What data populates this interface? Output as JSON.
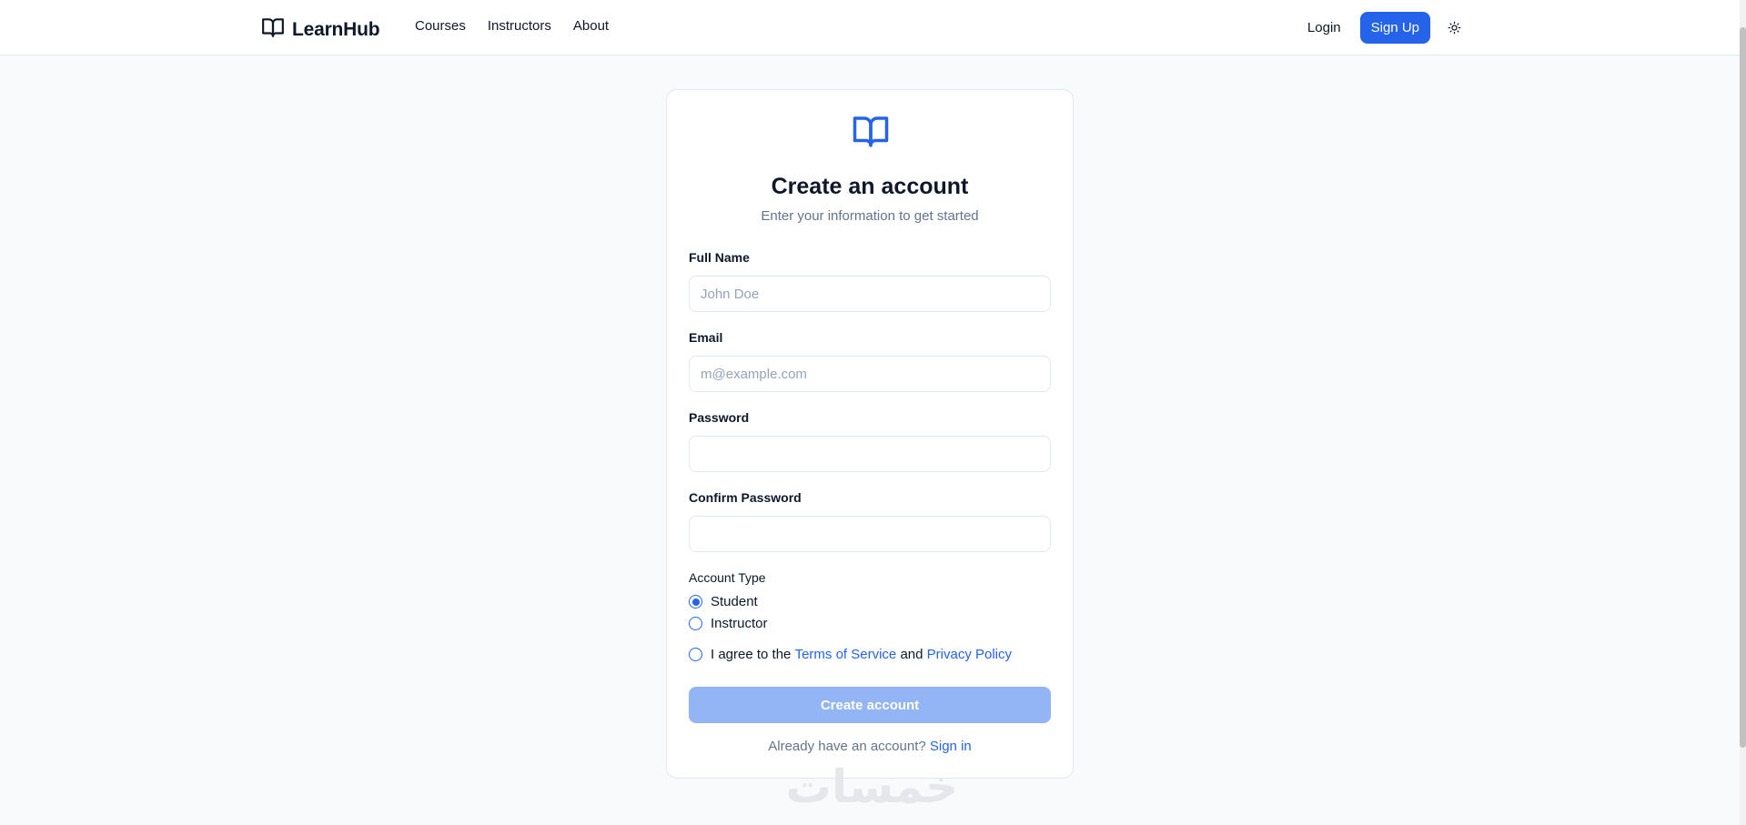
{
  "nav": {
    "brand": "LearnHub",
    "links": [
      "Courses",
      "Instructors",
      "About"
    ],
    "login": "Login",
    "signup": "Sign Up"
  },
  "card": {
    "title": "Create an account",
    "subtitle": "Enter your information to get started",
    "fields": [
      {
        "label": "Full Name",
        "placeholder": "John Doe",
        "value": ""
      },
      {
        "label": "Email",
        "placeholder": "m@example.com",
        "value": ""
      },
      {
        "label": "Password",
        "placeholder": "",
        "value": ""
      },
      {
        "label": "Confirm Password",
        "placeholder": "",
        "value": ""
      }
    ],
    "account_type": {
      "label": "Account Type",
      "options": [
        "Student",
        "Instructor"
      ],
      "selected": "Student"
    },
    "terms": {
      "prefix": "I agree to the ",
      "terms_link": "Terms of Service",
      "middle": " and ",
      "privacy_link": "Privacy Policy",
      "checked": false
    },
    "submit": "Create account",
    "footer": {
      "text": "Already have an account? ",
      "link": "Sign in"
    }
  },
  "watermark": "خمسات",
  "colors": {
    "accent": "#2563eb",
    "accent_disabled": "#93b4f5",
    "background": "#f8fafc",
    "muted_text": "#64748b"
  }
}
